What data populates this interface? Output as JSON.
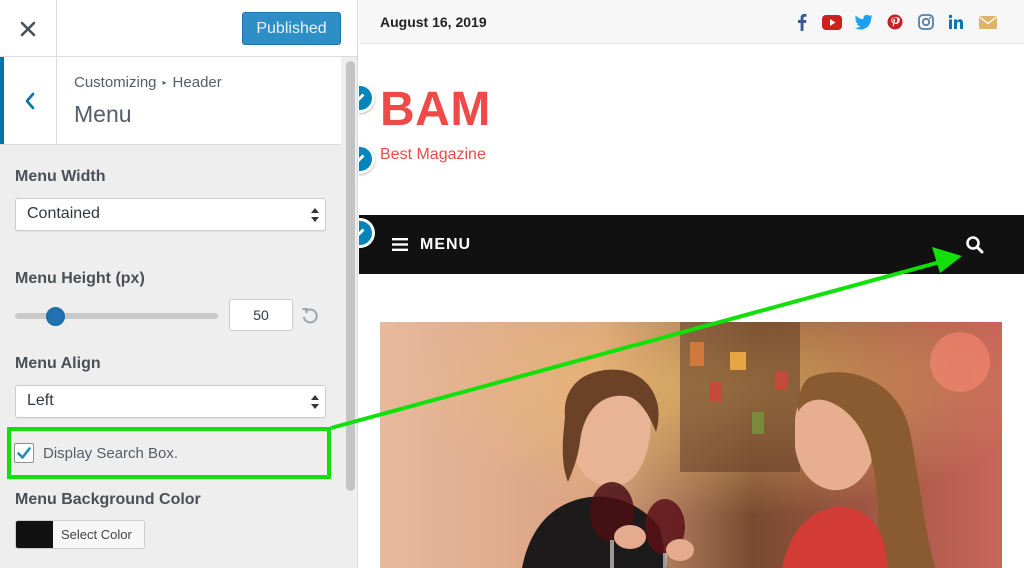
{
  "sidebar": {
    "close_label": "×",
    "publish_label": "Published",
    "breadcrumb": {
      "part1": "Customizing",
      "separator": "▸",
      "part2": "Header"
    },
    "section_title": "Menu",
    "menu_width": {
      "label": "Menu Width",
      "value": "Contained"
    },
    "menu_height": {
      "label": "Menu Height (px)",
      "value": "50",
      "slider_fraction": 0.2
    },
    "menu_align": {
      "label": "Menu Align",
      "value": "Left"
    },
    "display_search": {
      "label": "Display Search Box.",
      "checked": true
    },
    "menu_bg_color": {
      "label": "Menu Background Color",
      "button_label": "Select Color",
      "swatch": "#111111"
    }
  },
  "preview": {
    "date": "August 16, 2019",
    "social_icons": [
      "facebook-icon",
      "youtube-icon",
      "twitter-icon",
      "pinterest-icon",
      "instagram-icon",
      "linkedin-icon",
      "envelope-icon"
    ],
    "site_title": "BAM",
    "site_description": "Best Magazine",
    "menu_label": "MENU"
  },
  "colors": {
    "accent": "#0073aa",
    "publish_button": "#2e8fc6",
    "brand_red": "#ef4a47",
    "nav_bg": "#111111",
    "annotation_green": "#12e00a"
  }
}
